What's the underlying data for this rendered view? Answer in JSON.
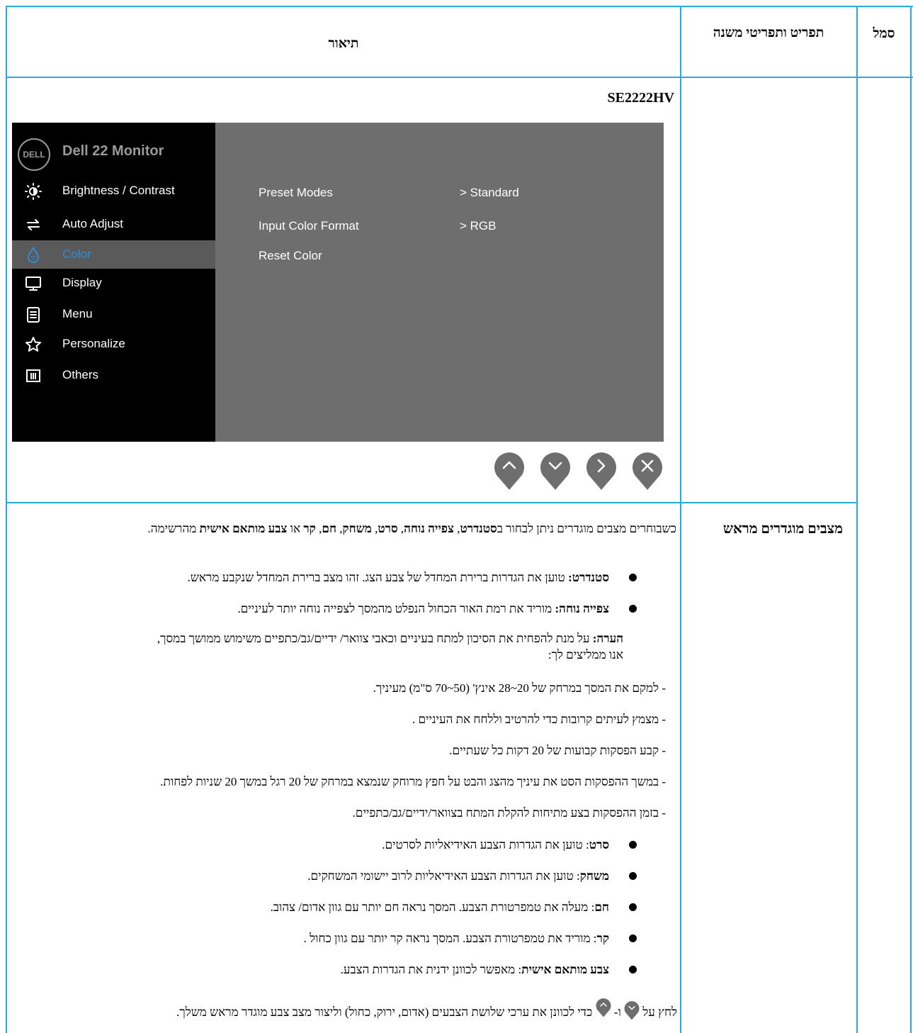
{
  "table": {
    "headers": {
      "symbol": "סמל",
      "item": "תפריט ותפריטי משנה",
      "description": "תיאור"
    }
  },
  "model": "SE2222HV",
  "osd": {
    "logo": "DELL",
    "title": "Dell 22 Monitor",
    "menu": [
      {
        "label": "Brightness / Contrast",
        "icon": "brightness-icon"
      },
      {
        "label": "Auto Adjust",
        "icon": "auto-adjust-icon"
      },
      {
        "label": "Color",
        "icon": "color-icon"
      },
      {
        "label": "Display",
        "icon": "display-icon"
      },
      {
        "label": "Menu",
        "icon": "menu-icon"
      },
      {
        "label": "Personalize",
        "icon": "star-icon"
      },
      {
        "label": "Others",
        "icon": "others-icon"
      }
    ],
    "active_item": "Color",
    "active_color": "#2b8fd6",
    "options": [
      {
        "label": "Preset Modes",
        "value": "> Standard"
      },
      {
        "label": "Input Color Format",
        "value": "> RGB"
      },
      {
        "label": "Reset Color",
        "value": ""
      }
    ],
    "buttons": [
      "up-icon",
      "down-icon",
      "right-icon",
      "close-icon"
    ]
  },
  "row2": {
    "term": "מצבים מוגדרים מראש",
    "intro": {
      "a": "כשבוחרים מצבים מוגדרים ניתן לבחור ב",
      "b": "סטנדרט",
      "c": ", ",
      "d": "צפייה נוחה",
      "e": ", ",
      "f": "סרט",
      "g": ", ",
      "h": "משחק",
      "i": ", ",
      "j": "חם",
      "k": ", ",
      "l": "קר",
      "m": " או ",
      "n": "צבע מותאם אישית",
      "o": " מהרשימה."
    },
    "bullets1": [
      {
        "term": "סטנדרט:",
        "text": " טוען את הגדרות ברירת המחדל של צבע הצג. זהו מצב ברירת המחדל שנקבע מראש."
      },
      {
        "term": "צפייה נוחה:",
        "text": " מוריד את רמת האור הכחול הנפלט מהמסך לצפייה נוחה יותר לעיניים."
      }
    ],
    "note": {
      "term": "הערה:",
      "line1": " על מנת להפחית את הסיכון למתח בעיניים וכאבי צוואר/ ידיים/גב/כתפיים משימוש ממושך במסך,",
      "line2": "אנו ממליצים לך:"
    },
    "tips": [
      "- למקם את המסך במרחק של 20~28 אינץ' (50~70 ס\"מ) מעיניך.",
      "- מצמץ לעיתים קרובות כדי להרטיב וללחח את העיניים .",
      "- קבע הפסקות קבועות של 20 דקות כל שעתיים.",
      "- במשך ההפסקות הסט את עיניך מהצג והבט על חפץ מרוחק שנמצא במרחק של  20 רגל במשך 20 שניות לפחות.",
      "- בזמן ההפסקות בצע מתיחות להקלת המתח בצוואר/ידיים/גב/כתפיים."
    ],
    "bullets2": [
      {
        "term": "סרט",
        "text": ": טוען את הגדרות הצבע האידיאליות לסרטים."
      },
      {
        "term": "משחק",
        "text": ": טוען את הגדרות הצבע האידיאליות לרוב יישומי המשחקים."
      },
      {
        "term": "חם",
        "text": ": מעלה את טמפרטורת הצבע. המסך נראה חם יותר עם גוון אדום/ צהוב."
      },
      {
        "term": "קר",
        "text": ": מוריד את טמפרטורת הצבע. המסך נראה קר יותר עם גוון כחול ."
      },
      {
        "term": "צבע מותאם אישית",
        "text": ": מאפשר לכוונן ידנית את הגדרות הצבע."
      }
    ],
    "last": {
      "a": "לחץ על",
      "b": "ו-",
      "c": "כדי לכוונן את ערכי שלושת הצבעים (אדום, ירוק, כחול) וליצור מצב צבע מוגדר מראש משלך."
    }
  },
  "colors": {
    "border": "#29a9e0",
    "osd_bg": "#6e6e6e",
    "osd_side": "#000000"
  }
}
